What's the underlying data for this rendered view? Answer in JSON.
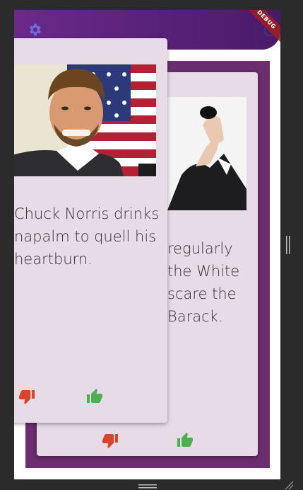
{
  "app": {
    "debug_banner": "DEBUG",
    "icons": {
      "settings": "gear-icon",
      "profile": "person-icon",
      "dislike": "thumb-down-icon",
      "like": "thumb-up-icon"
    },
    "colors": {
      "appbar": "#5a2278",
      "deck": "#6b2e6e",
      "card": "#e6dbe6",
      "dislike": "#d9442a",
      "like": "#4caf50"
    }
  },
  "cards": {
    "front": {
      "joke_lines": [
        "Chuck Norris drinks",
        "napalm to quell his",
        "heartburn."
      ]
    },
    "back": {
      "joke_lines": [
        "regularly",
        "the White",
        "scare the",
        "Barack."
      ]
    }
  }
}
